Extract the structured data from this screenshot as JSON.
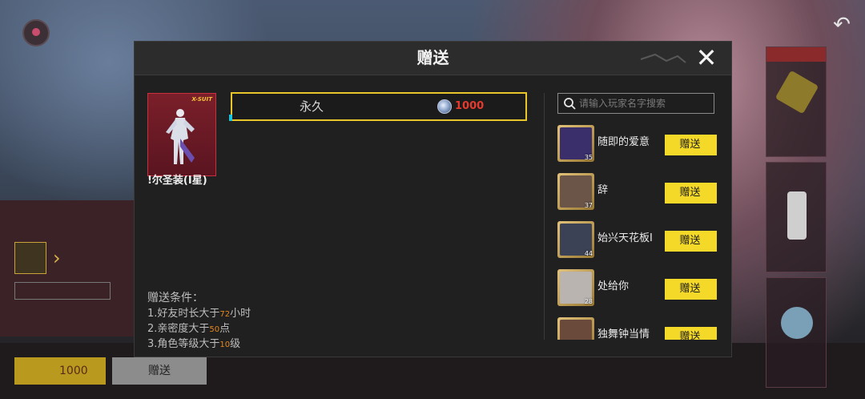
{
  "dialog": {
    "title": "赠送",
    "item": {
      "name": "!尔圣装(I星)",
      "badge": "X-SUIT"
    },
    "option": {
      "label": "永久",
      "price": "1000"
    },
    "conditions": {
      "title": "赠送条件：",
      "lines": [
        {
          "prefix": "1.好友时长大于",
          "value": "72",
          "suffix": "小时"
        },
        {
          "prefix": "2.亲密度大于",
          "value": "50",
          "suffix": "点"
        },
        {
          "prefix": "3.角色等级大于",
          "value": "10",
          "suffix": "级"
        }
      ]
    },
    "search": {
      "placeholder": "请输入玩家名字搜索"
    },
    "friends": [
      {
        "name": "随即的爱意",
        "level": "35",
        "button": "赠送",
        "avatar": "#3a2f6a"
      },
      {
        "name": "辞",
        "level": "37",
        "button": "赠送",
        "avatar": "#6a5548"
      },
      {
        "name": "始兴天花板I",
        "level": "44",
        "button": "赠送",
        "avatar": "#3c4256"
      },
      {
        "name": "处给你",
        "level": "28",
        "button": "赠送",
        "avatar": "#b9b4b0"
      },
      {
        "name": "独舞钟当情",
        "level": "",
        "button": "赠送",
        "avatar": "#6a4a3a"
      }
    ]
  },
  "background": {
    "buy_price": "1000",
    "gift_label": "赠送"
  },
  "colors": {
    "accent_yellow": "#f5d928",
    "price_red": "#e53a2e",
    "condition_orange": "#e3871d",
    "cyan_edge": "#19c7e0"
  }
}
